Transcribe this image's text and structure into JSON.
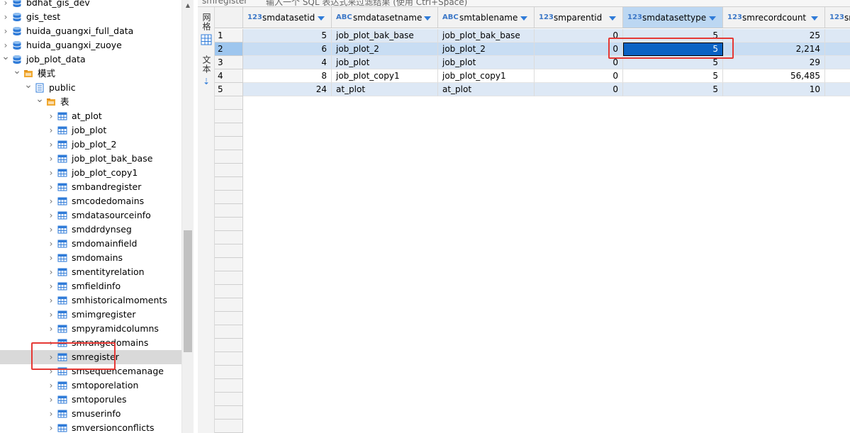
{
  "nav": {
    "items": [
      {
        "label": "bdhat_gis_dev",
        "kind": "database",
        "level": 0,
        "expanded": false
      },
      {
        "label": "gis_test",
        "kind": "database",
        "level": 0,
        "expanded": false
      },
      {
        "label": "huida_guangxi_full_data",
        "kind": "database",
        "level": 0,
        "expanded": false
      },
      {
        "label": "huida_guangxi_zuoye",
        "kind": "database",
        "level": 0,
        "expanded": false
      },
      {
        "label": "job_plot_data",
        "kind": "database",
        "level": 0,
        "expanded": true
      },
      {
        "label": "模式",
        "kind": "folder",
        "level": 1,
        "expanded": true
      },
      {
        "label": "public",
        "kind": "schema",
        "level": 2,
        "expanded": true
      },
      {
        "label": "表",
        "kind": "folder",
        "level": 3,
        "expanded": true
      },
      {
        "label": "at_plot",
        "kind": "table",
        "level": 4
      },
      {
        "label": "job_plot",
        "kind": "table",
        "level": 4
      },
      {
        "label": "job_plot_2",
        "kind": "table",
        "level": 4
      },
      {
        "label": "job_plot_bak_base",
        "kind": "table",
        "level": 4
      },
      {
        "label": "job_plot_copy1",
        "kind": "table",
        "level": 4
      },
      {
        "label": "smbandregister",
        "kind": "table",
        "level": 4
      },
      {
        "label": "smcodedomains",
        "kind": "table",
        "level": 4
      },
      {
        "label": "smdatasourceinfo",
        "kind": "table",
        "level": 4
      },
      {
        "label": "smddrdynseg",
        "kind": "table",
        "level": 4
      },
      {
        "label": "smdomainfield",
        "kind": "table",
        "level": 4
      },
      {
        "label": "smdomains",
        "kind": "table",
        "level": 4
      },
      {
        "label": "smentityrelation",
        "kind": "table",
        "level": 4
      },
      {
        "label": "smfieldinfo",
        "kind": "table",
        "level": 4
      },
      {
        "label": "smhistoricalmoments",
        "kind": "table",
        "level": 4
      },
      {
        "label": "smimgregister",
        "kind": "table",
        "level": 4
      },
      {
        "label": "smpyramidcolumns",
        "kind": "table",
        "level": 4
      },
      {
        "label": "smrangedomains",
        "kind": "table",
        "level": 4
      },
      {
        "label": "smregister",
        "kind": "table",
        "level": 4,
        "selected": true
      },
      {
        "label": "smsequencemanage",
        "kind": "table",
        "level": 4
      },
      {
        "label": "smtoporelation",
        "kind": "table",
        "level": 4
      },
      {
        "label": "smtoporules",
        "kind": "table",
        "level": 4
      },
      {
        "label": "smuserinfo",
        "kind": "table",
        "level": 4
      },
      {
        "label": "smversionconflicts",
        "kind": "table",
        "level": 4
      }
    ]
  },
  "editor": {
    "tab_label": "smregister",
    "filter_hint": "输入一个 SQL 表达式来过滤结果 (使用 Ctrl+Space)"
  },
  "side_toolbar": {
    "grid_label": "网格",
    "text_label": "文本"
  },
  "grid": {
    "columns": [
      {
        "type": "123",
        "name": "smdatasetid"
      },
      {
        "type": "ABC",
        "name": "smdatasetname"
      },
      {
        "type": "ABC",
        "name": "smtablename"
      },
      {
        "type": "123",
        "name": "smparentid"
      },
      {
        "type": "123",
        "name": "smdatasettype",
        "selected": true
      },
      {
        "type": "123",
        "name": "smrecordcount"
      },
      {
        "type": "123",
        "name": "sm"
      }
    ],
    "rows": [
      {
        "num": "1",
        "cells": [
          "5",
          "job_plot_bak_base",
          "job_plot_bak_base",
          "0",
          "5",
          "25"
        ]
      },
      {
        "num": "2",
        "cells": [
          "6",
          "job_plot_2",
          "job_plot_2",
          "0",
          "5",
          "2,214"
        ],
        "selected": true
      },
      {
        "num": "3",
        "cells": [
          "4",
          "job_plot",
          "job_plot",
          "0",
          "5",
          "29"
        ]
      },
      {
        "num": "4",
        "cells": [
          "8",
          "job_plot_copy1",
          "job_plot_copy1",
          "0",
          "5",
          "56,485"
        ]
      },
      {
        "num": "5",
        "cells": [
          "24",
          "at_plot",
          "at_plot",
          "0",
          "5",
          "10"
        ]
      }
    ]
  },
  "colors": {
    "accent": "#2f7bd8",
    "highlight": "#e53935",
    "focus_cell": "#0a62c4"
  }
}
